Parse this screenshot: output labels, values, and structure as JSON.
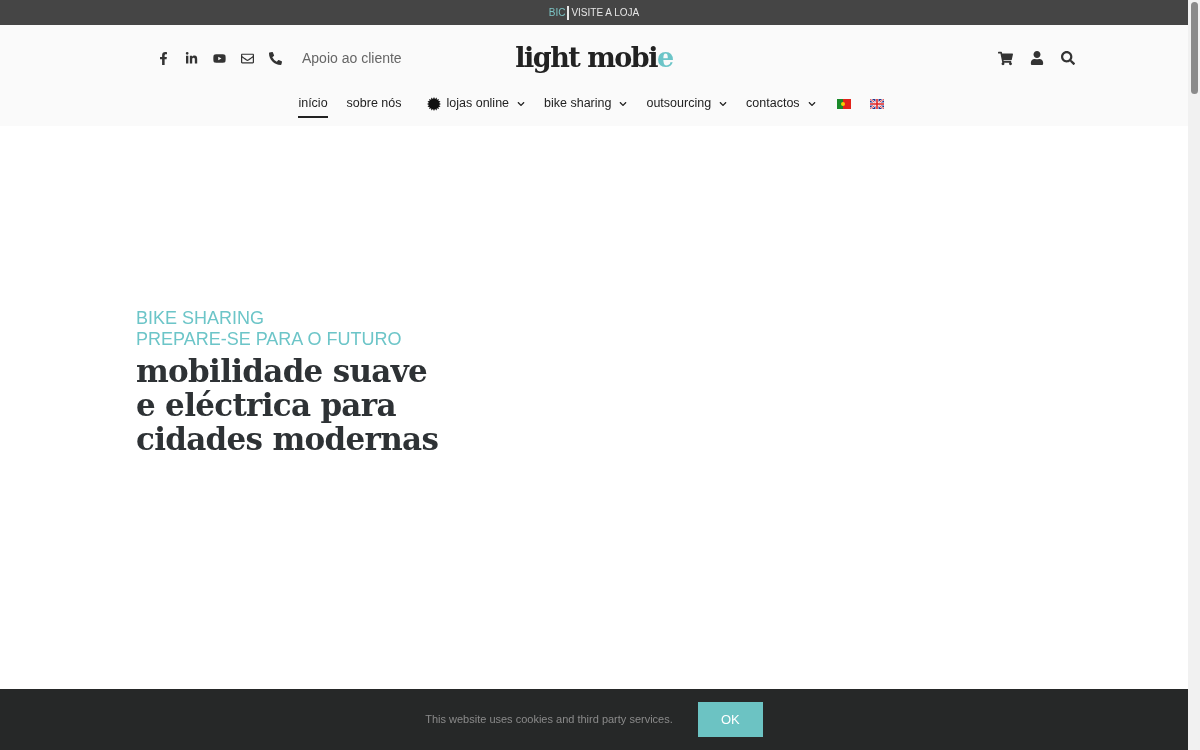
{
  "top_bar": {
    "typed_text": "BIC",
    "link": "VISITE A LOJA"
  },
  "header": {
    "support_link": "Apoio ao cliente",
    "logo": {
      "text": "light mobi",
      "accent": "e"
    }
  },
  "nav": [
    {
      "label": "início",
      "kind": "link",
      "selected": true
    },
    {
      "label": "sobre nós",
      "kind": "link",
      "selected": false
    },
    {
      "label": "lojas online",
      "kind": "featured-menu",
      "selected": false
    },
    {
      "label": "bike sharing",
      "kind": "menu",
      "selected": false
    },
    {
      "label": "outsourcing",
      "kind": "menu",
      "selected": false
    },
    {
      "label": "contactos",
      "kind": "menu",
      "selected": false
    }
  ],
  "hero": {
    "eyebrow": [
      "BIKE SHARING",
      "PREPARE-SE PARA O FUTURO"
    ],
    "headline": [
      "mobilidade suave",
      "e eléctrica para",
      "cidades modernas"
    ]
  },
  "cookie_bar": {
    "message": "This website uses cookies and third party services.",
    "button": "OK"
  }
}
